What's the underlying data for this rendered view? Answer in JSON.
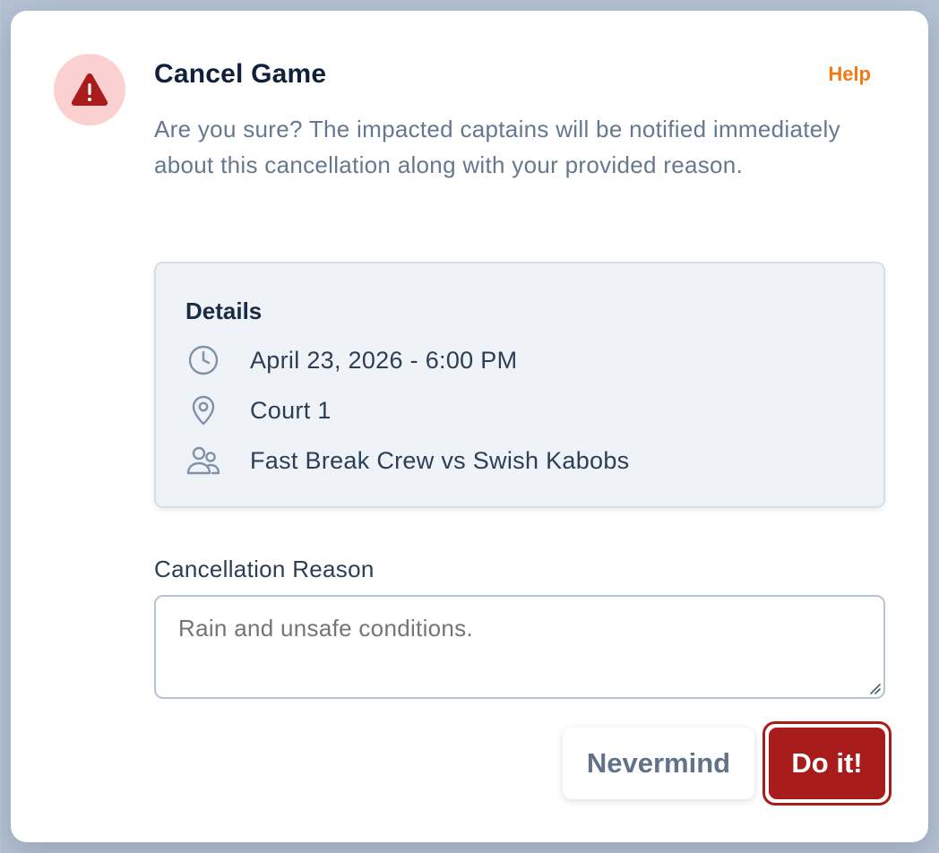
{
  "modal": {
    "title": "Cancel Game",
    "help_label": "Help",
    "description": "Are you sure? The impacted captains will be notified immediately about this cancellation along with your provided reason."
  },
  "details": {
    "heading": "Details",
    "date_time": "April 23, 2026 - 6:00 PM",
    "location": "Court 1",
    "matchup": "Fast Break Crew vs Swish Kabobs"
  },
  "reason": {
    "label": "Cancellation Reason",
    "placeholder": "Rain and unsafe conditions.",
    "value": ""
  },
  "actions": {
    "nevermind_label": "Nevermind",
    "confirm_label": "Do it!"
  },
  "icons": {
    "alert": "warning-triangle-icon",
    "date": "clock-icon",
    "location": "map-pin-icon",
    "teams": "users-icon"
  },
  "colors": {
    "danger": "#a91c1c",
    "danger_soft": "#fbd0d0",
    "help": "#f27a16",
    "title": "#0f2038"
  }
}
